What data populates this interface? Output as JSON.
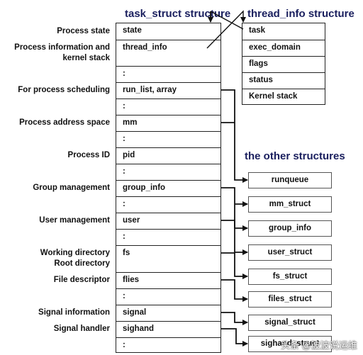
{
  "titles": {
    "task_struct": "task_struct structure",
    "thread_info": "thread_info structure",
    "other": "the other structures"
  },
  "task_struct": {
    "labels": [
      {
        "row": 0,
        "text": "Process state"
      },
      {
        "row": 1,
        "text": "Process information and"
      },
      {
        "row": 1,
        "text2": "kernel stack"
      },
      {
        "row": 3,
        "text": "For process scheduling"
      },
      {
        "row": 5,
        "text": "Process address space"
      },
      {
        "row": 7,
        "text": "Process ID"
      },
      {
        "row": 9,
        "text": "Group management"
      },
      {
        "row": 11,
        "text": "User management"
      },
      {
        "row": 13,
        "text": "Working directory"
      },
      {
        "row": 13,
        "text2": "Root directory"
      },
      {
        "row": 14,
        "text": "File descriptor"
      },
      {
        "row": 16,
        "text": "Signal information"
      },
      {
        "row": 17,
        "text": "Signal handler"
      }
    ],
    "fields": [
      "state",
      "thread_info",
      ":",
      "run_list, array",
      ":",
      "mm",
      ":",
      "pid",
      ":",
      "group_info",
      ":",
      "user",
      ":",
      "fs",
      "flies",
      ":",
      "signal",
      "sighand",
      ":"
    ]
  },
  "thread_info": {
    "fields": [
      "task",
      "exec_domain",
      "flags",
      "status",
      "Kernel stack"
    ]
  },
  "other_structures": [
    "runqueue",
    "mm_struct",
    "group_info",
    "user_struct",
    "fs_struct",
    "files_struct",
    "signal_struct",
    "sighand_struct"
  ],
  "connections": [
    {
      "from": "run_list, array",
      "to": "runqueue"
    },
    {
      "from": "mm",
      "to": "mm_struct"
    },
    {
      "from": "group_info",
      "to": "group_info"
    },
    {
      "from": "user",
      "to": "user_struct"
    },
    {
      "from": "fs",
      "to": "fs_struct"
    },
    {
      "from": "flies",
      "to": "files_struct"
    },
    {
      "from": "signal",
      "to": "signal_struct"
    },
    {
      "from": "sighand",
      "to": "sighand_struct"
    },
    {
      "from": "thread_info",
      "to": "thread_info structure"
    },
    {
      "from": "task",
      "to": "task_struct structure"
    }
  ],
  "watermark": "头条 @波波说运维"
}
